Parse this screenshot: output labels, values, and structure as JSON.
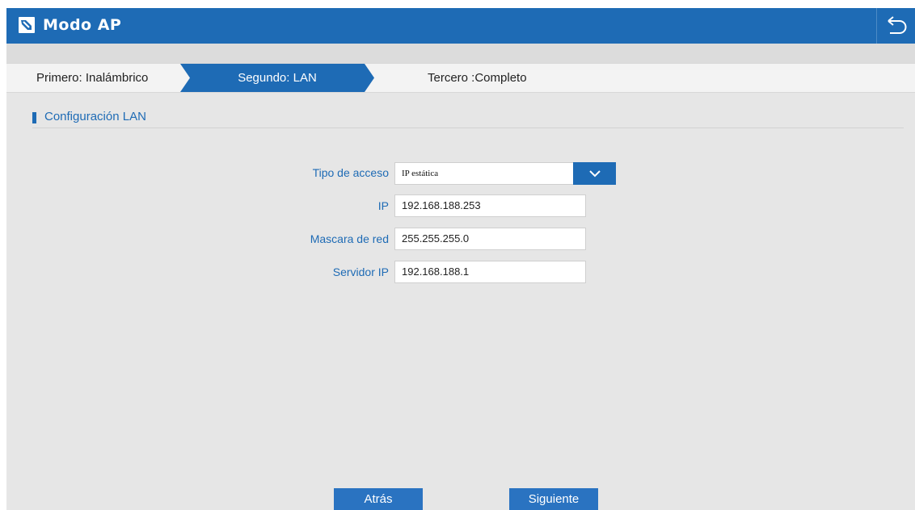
{
  "header": {
    "title": "Modo AP",
    "logo_icon": "router-logo-icon",
    "back_icon": "return-arrow-icon"
  },
  "steps": [
    {
      "label": "Primero: Inalámbrico",
      "active": false
    },
    {
      "label": "Segundo: LAN",
      "active": true
    },
    {
      "label": "Tercero :Completo",
      "active": false
    }
  ],
  "section": {
    "title": "Configuración LAN"
  },
  "form": {
    "access_type": {
      "label": "Tipo de acceso",
      "value": "IP estática"
    },
    "ip": {
      "label": "IP",
      "value": "192.168.188.253"
    },
    "netmask": {
      "label": "Mascara de red",
      "value": "255.255.255.0"
    },
    "server_ip": {
      "label": "Servidor IP",
      "value": "192.168.188.1"
    }
  },
  "buttons": {
    "back": "Atrás",
    "next": "Siguiente"
  },
  "colors": {
    "accent": "#1e6bb5",
    "background": "#e6e6e6"
  }
}
